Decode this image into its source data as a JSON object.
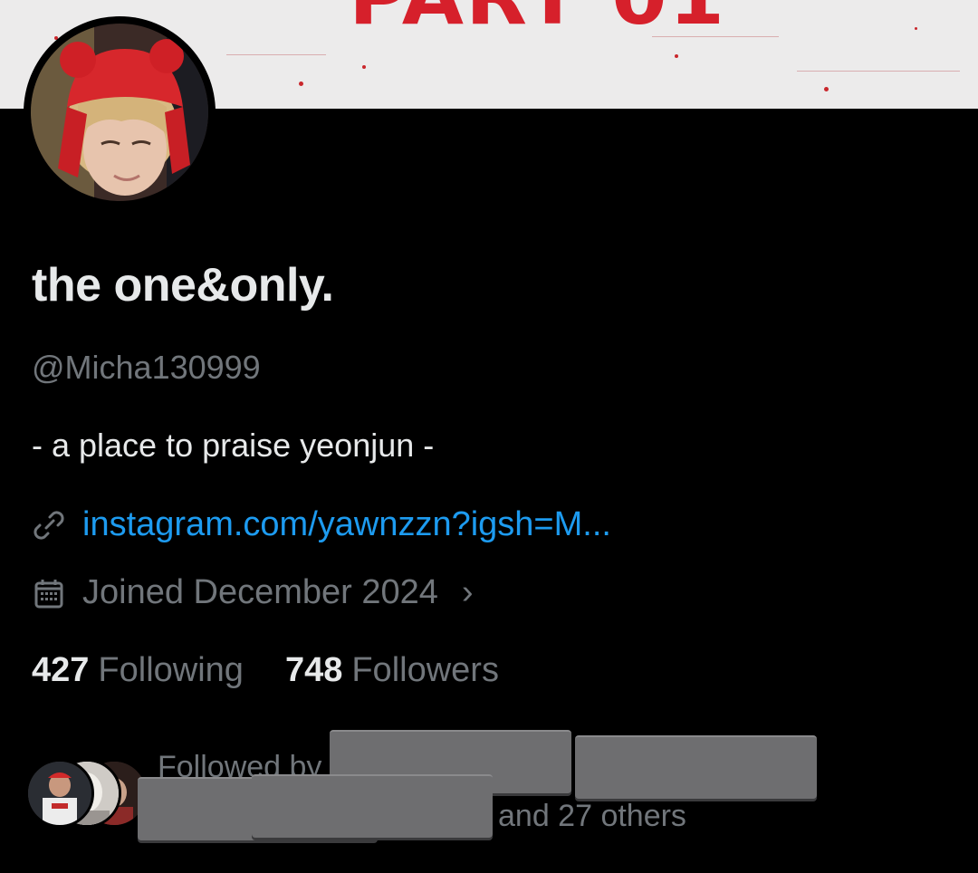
{
  "banner": {
    "text": "PART 01",
    "accent_color": "#d6202b",
    "background": "#ecebeb"
  },
  "profile": {
    "display_name": "the one&only.",
    "handle": "@Micha130999",
    "bio": "- a place to praise yeonjun -",
    "link": "instagram.com/yawnzzn?igsh=M...",
    "joined": "Joined December 2024",
    "link_icon": "link-icon",
    "calendar_icon": "calendar-icon"
  },
  "stats": {
    "following_count": "427",
    "following_label": "Following",
    "followers_count": "748",
    "followers_label": "Followers"
  },
  "followed_by": {
    "prefix": "Followed by",
    "suffix": "and 27 others"
  },
  "colors": {
    "background": "#000000",
    "primary_text": "#e7e9ea",
    "secondary_text": "#71767b",
    "link": "#1d9bf0"
  }
}
